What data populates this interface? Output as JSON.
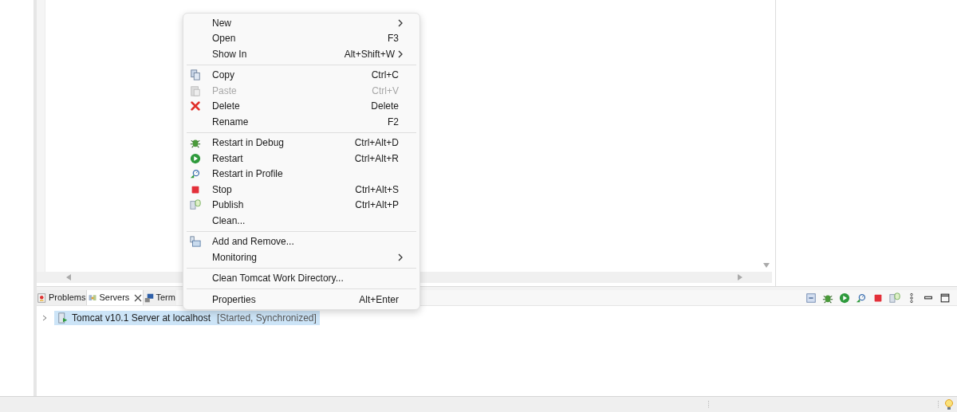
{
  "menu": {
    "groups": [
      [
        {
          "label": "New",
          "submenu": true,
          "disabled": false
        },
        {
          "label": "Open",
          "shortcut": "F3",
          "submenu": false,
          "disabled": false
        },
        {
          "label": "Show In",
          "shortcut": "Alt+Shift+W",
          "submenu": true,
          "disabled": false
        }
      ],
      [
        {
          "label": "Copy",
          "shortcut": "Ctrl+C",
          "submenu": false,
          "disabled": false
        },
        {
          "label": "Paste",
          "shortcut": "Ctrl+V",
          "submenu": false,
          "disabled": true
        },
        {
          "label": "Delete",
          "shortcut": "Delete",
          "submenu": false,
          "disabled": false
        },
        {
          "label": "Rename",
          "shortcut": "F2",
          "submenu": false,
          "disabled": false
        }
      ],
      [
        {
          "label": "Restart in Debug",
          "shortcut": "Ctrl+Alt+D",
          "submenu": false,
          "disabled": false
        },
        {
          "label": "Restart",
          "shortcut": "Ctrl+Alt+R",
          "submenu": false,
          "disabled": false
        },
        {
          "label": "Restart in Profile",
          "submenu": false,
          "disabled": false
        },
        {
          "label": "Stop",
          "shortcut": "Ctrl+Alt+S",
          "submenu": false,
          "disabled": false
        },
        {
          "label": "Publish",
          "shortcut": "Ctrl+Alt+P",
          "submenu": false,
          "disabled": false
        },
        {
          "label": "Clean...",
          "submenu": false,
          "disabled": false
        }
      ],
      [
        {
          "label": "Add and Remove...",
          "submenu": false,
          "disabled": false
        },
        {
          "label": "Monitoring",
          "submenu": true,
          "disabled": false
        }
      ],
      [
        {
          "label": "Clean Tomcat Work Directory...",
          "submenu": false,
          "disabled": false
        }
      ],
      [
        {
          "label": "Properties",
          "shortcut": "Alt+Enter",
          "submenu": false,
          "disabled": false
        }
      ]
    ]
  },
  "tabs": [
    {
      "label": "Problems",
      "selected": false,
      "closable": false
    },
    {
      "label": "Servers",
      "selected": true,
      "closable": true
    },
    {
      "label": "Term",
      "selected": false,
      "closable": false
    }
  ],
  "tree": [
    {
      "label": "Tomcat v10.1 Server at localhost",
      "status": "[Started, Synchronized]",
      "selected": true,
      "expanded": false
    }
  ]
}
